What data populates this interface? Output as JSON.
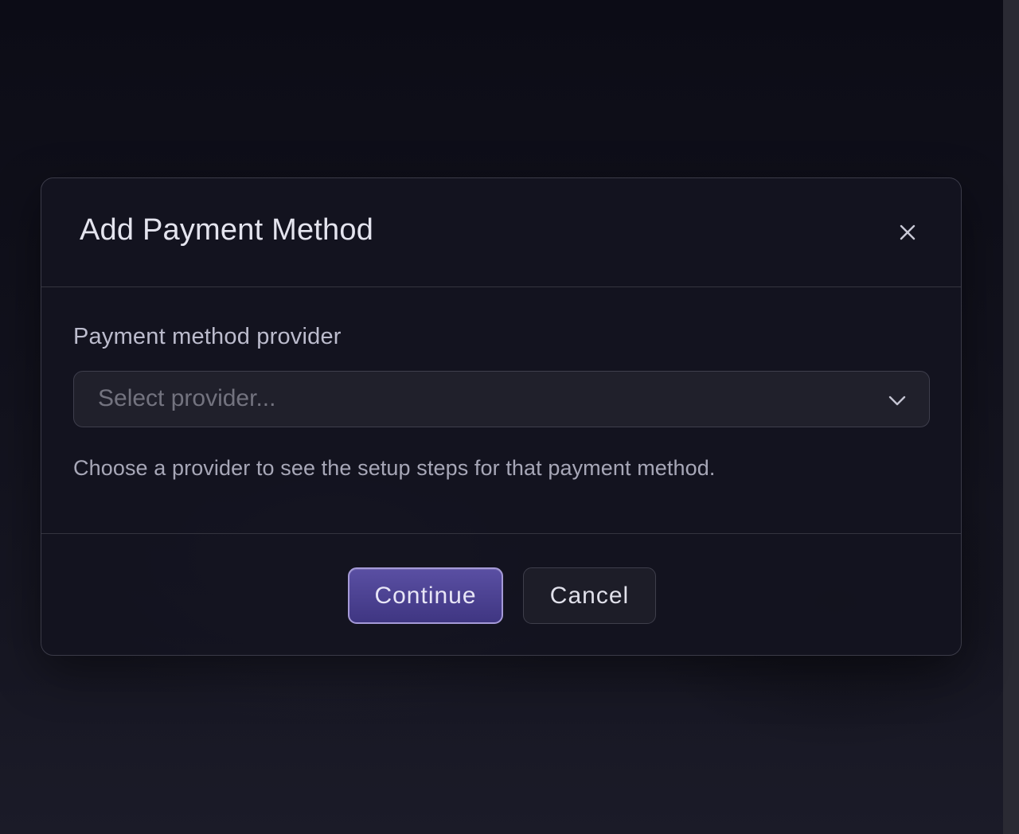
{
  "modal": {
    "title": "Add Payment Method",
    "close_icon": "close-icon"
  },
  "form": {
    "provider_label": "Payment method provider",
    "provider_select": {
      "placeholder": "Select provider...",
      "selected_value": "",
      "icon": "chevron-down-icon"
    },
    "helper_text": "Choose a provider to see the setup steps for that payment method."
  },
  "footer": {
    "continue_label": "Continue",
    "cancel_label": "Cancel"
  },
  "colors": {
    "background": "#0c0c16",
    "modal_border": "#3b3b48",
    "primary_button": "#4b4192",
    "primary_button_border": "#a59ad8"
  }
}
